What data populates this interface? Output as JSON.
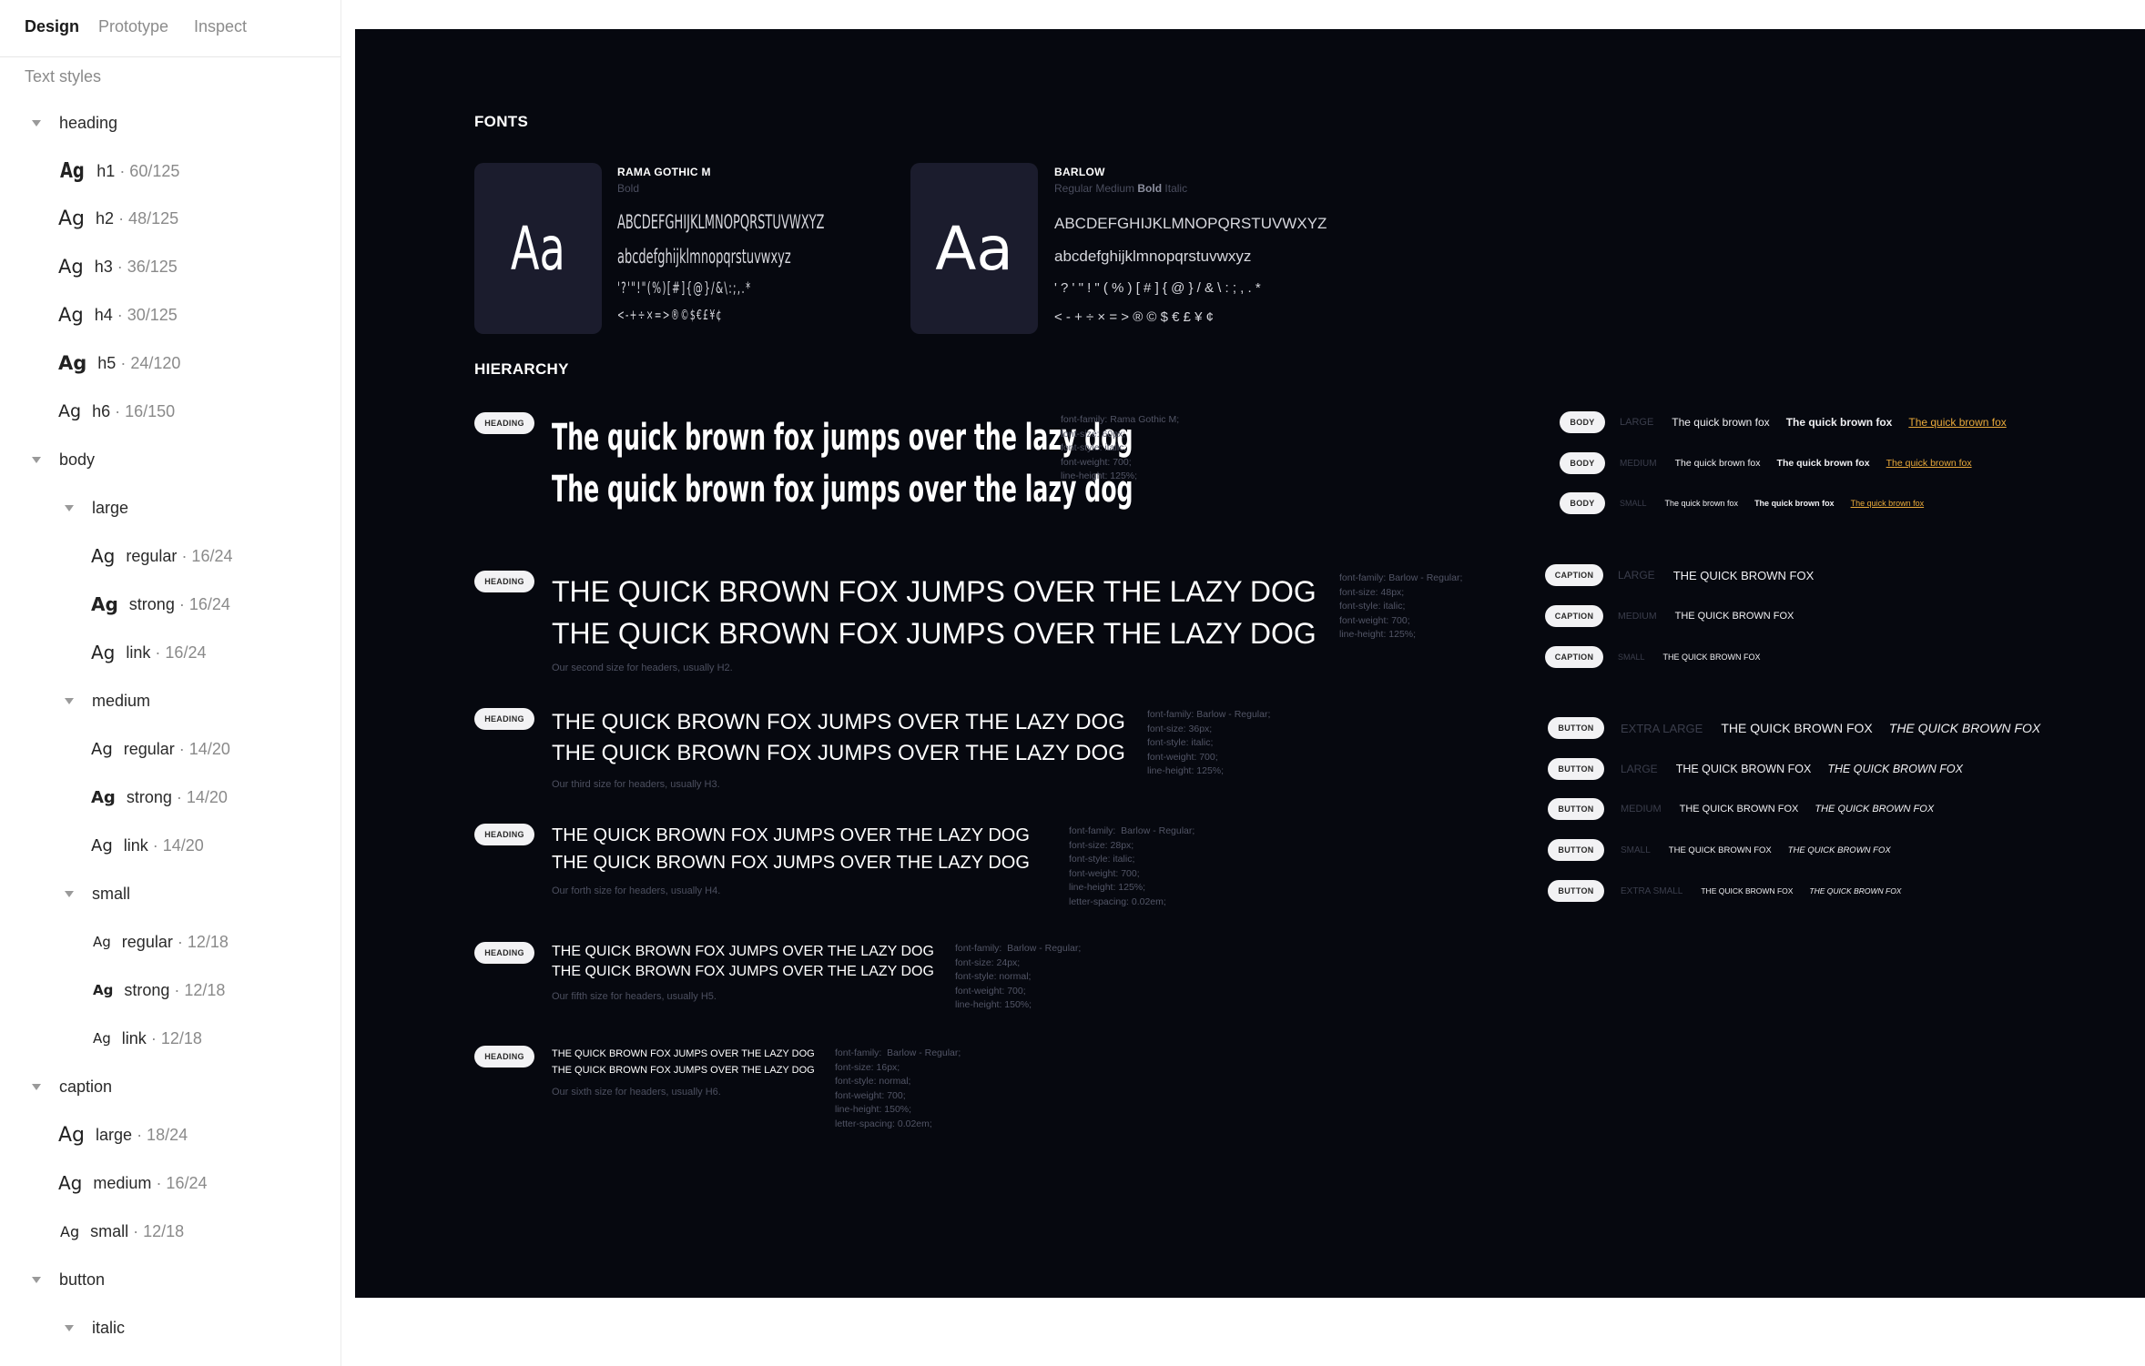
{
  "tabs": [
    "Design",
    "Prototype",
    "Inspect"
  ],
  "sidebar": {
    "section_title": "Text styles",
    "items": [
      {
        "label": "heading",
        "type": "group"
      },
      {
        "label": "h1",
        "meta": "· 60/125",
        "ag": "Ag"
      },
      {
        "label": "h2",
        "meta": "· 48/125",
        "ag": "Ag"
      },
      {
        "label": "h3",
        "meta": "· 36/125",
        "ag": "Ag"
      },
      {
        "label": "h4",
        "meta": "· 30/125",
        "ag": "Ag"
      },
      {
        "label": "h5",
        "meta": "· 24/120",
        "ag": "Ag"
      },
      {
        "label": "h6",
        "meta": "· 16/150",
        "ag": "Ag"
      },
      {
        "label": "body",
        "type": "group"
      },
      {
        "label": "large",
        "type": "group"
      },
      {
        "label": "regular",
        "meta": "· 16/24",
        "ag": "Ag"
      },
      {
        "label": "strong",
        "meta": "· 16/24",
        "ag": "Ag"
      },
      {
        "label": "link",
        "meta": "· 16/24",
        "ag": "Ag"
      },
      {
        "label": "medium",
        "type": "group"
      },
      {
        "label": "regular",
        "meta": "· 14/20",
        "ag": "Ag"
      },
      {
        "label": "strong",
        "meta": "· 14/20",
        "ag": "Ag"
      },
      {
        "label": "link",
        "meta": "· 14/20",
        "ag": "Ag"
      },
      {
        "label": "small",
        "type": "group"
      },
      {
        "label": "regular",
        "meta": "· 12/18",
        "ag": "Ag"
      },
      {
        "label": "strong",
        "meta": "· 12/18",
        "ag": "Ag"
      },
      {
        "label": "link",
        "meta": "· 12/18",
        "ag": "Ag"
      },
      {
        "label": "caption",
        "type": "group"
      },
      {
        "label": "large",
        "meta": "· 18/24",
        "ag": "Ag"
      },
      {
        "label": "medium",
        "meta": "· 16/24",
        "ag": "Ag"
      },
      {
        "label": "small",
        "meta": "· 12/18",
        "ag": "Ag"
      },
      {
        "label": "button",
        "type": "group"
      },
      {
        "label": "italic",
        "type": "group"
      }
    ]
  },
  "canvas": {
    "fonts_label": "FONTS",
    "hierarchy_label": "HIERARCHY",
    "fonts": [
      {
        "name": "RAMA GOTHIC M",
        "weights_plain": "Bold",
        "sample": "Aa",
        "upper": "ABCDEFGHIJKLMNOPQRSTUVWXYZ",
        "lower": "abcdefghijklmnopqrstuvwxyz",
        "punct": "'?'\"!\"(%)[#]{@}/&\\:;,.*",
        "symbols": "<-+÷×=>®©$€£¥¢"
      },
      {
        "name": "BARLOW",
        "weights_plain": "Regular Medium",
        "weights_bold": "Bold",
        "weights_italic": "Italic",
        "sample": "Aa",
        "upper": "ABCDEFGHIJKLMNOPQRSTUVWXYZ",
        "lower": "abcdefghijklmnopqrstuvwxyz",
        "punct": "' ? ' \" ! \" ( % ) [ # ] { @ } / & \\ : ; , . *",
        "symbols": "< - + ÷ × = > ® © $ € £ ¥ ¢"
      }
    ],
    "headings": [
      {
        "pill": "HEADING",
        "line1": "The quick brown fox jumps over the lazy dog",
        "line2": "The quick brown fox jumps over the lazy dog",
        "desc": "",
        "spec": "font-family: Rama Gothic M;\nfont-size: 60px;\nfont-style: italic;\nfont-weight: 700;\nline-height: 125%;"
      },
      {
        "pill": "HEADING",
        "line1": "THE QUICK BROWN FOX JUMPS OVER THE LAZY DOG",
        "line2": "THE QUICK BROWN FOX JUMPS OVER THE LAZY DOG",
        "desc": "Our second size for headers, usually H2.",
        "spec": "font-family: Barlow - Regular;\nfont-size: 48px;\nfont-style: italic;\nfont-weight: 700;\nline-height: 125%;"
      },
      {
        "pill": "HEADING",
        "line1": "THE QUICK BROWN FOX JUMPS OVER THE LAZY DOG",
        "line2": "THE QUICK BROWN FOX JUMPS OVER THE LAZY DOG",
        "desc": "Our third size for headers, usually H3.",
        "spec": "font-family: Barlow - Regular;\nfont-size: 36px;\nfont-style: italic;\nfont-weight: 700;\nline-height: 125%;"
      },
      {
        "pill": "HEADING",
        "line1": "THE QUICK BROWN FOX JUMPS OVER THE LAZY DOG",
        "line2": "THE QUICK BROWN FOX JUMPS OVER THE LAZY DOG",
        "desc": "Our forth size for headers, usually H4.",
        "spec": "font-family:  Barlow - Regular;\nfont-size: 28px;\nfont-style: italic;\nfont-weight: 700;\nline-height: 125%;\nletter-spacing: 0.02em;"
      },
      {
        "pill": "HEADING",
        "line1": "THE QUICK BROWN FOX JUMPS OVER THE LAZY DOG",
        "line2": "THE QUICK BROWN FOX JUMPS OVER THE LAZY DOG",
        "desc": "Our fifth size for headers, usually H5.",
        "spec": "font-family:  Barlow - Regular;\nfont-size: 24px;\nfont-style: normal;\nfont-weight: 700;\nline-height: 150%;"
      },
      {
        "pill": "HEADING",
        "line1": "THE QUICK BROWN FOX JUMPS OVER THE LAZY DOG",
        "line2": "THE QUICK BROWN FOX JUMPS OVER THE LAZY DOG",
        "desc": "Our sixth size for headers, usually H6.",
        "spec": "font-family:  Barlow - Regular;\nfont-size: 16px;\nfont-style: normal;\nfont-weight: 700;\nline-height: 150%;\nletter-spacing: 0.02em;"
      }
    ],
    "body_rows": [
      {
        "pill": "BODY",
        "size": "LARGE",
        "regular": "The quick brown fox",
        "strong": "The quick brown fox",
        "link": "The quick brown fox"
      },
      {
        "pill": "BODY",
        "size": "MEDIUM",
        "regular": "The quick brown fox",
        "strong": "The quick brown fox",
        "link": "The quick brown fox"
      },
      {
        "pill": "BODY",
        "size": "SMALL",
        "regular": "The quick brown fox",
        "strong": "The quick brown fox",
        "link": "The quick brown fox"
      }
    ],
    "caption_rows": [
      {
        "pill": "CAPTION",
        "size": "LARGE",
        "text": "THE QUICK BROWN FOX"
      },
      {
        "pill": "CAPTION",
        "size": "MEDIUM",
        "text": "THE QUICK BROWN FOX"
      },
      {
        "pill": "CAPTION",
        "size": "SMALL",
        "text": "THE QUICK BROWN FOX"
      }
    ],
    "button_rows": [
      {
        "pill": "BUTTON",
        "size": "EXTRA LARGE",
        "text": "THE QUICK BROWN FOX",
        "italic": "THE QUICK BROWN FOX"
      },
      {
        "pill": "BUTTON",
        "size": "LARGE",
        "text": "THE QUICK BROWN FOX",
        "italic": "THE QUICK BROWN FOX"
      },
      {
        "pill": "BUTTON",
        "size": "MEDIUM",
        "text": "THE QUICK BROWN FOX",
        "italic": "THE QUICK BROWN FOX"
      },
      {
        "pill": "BUTTON",
        "size": "SMALL",
        "text": "THE QUICK BROWN FOX",
        "italic": "THE QUICK BROWN FOX"
      },
      {
        "pill": "BUTTON",
        "size": "EXTRA SMALL",
        "text": "THE QUICK BROWN FOX",
        "italic": "THE QUICK BROWN FOX"
      }
    ]
  }
}
